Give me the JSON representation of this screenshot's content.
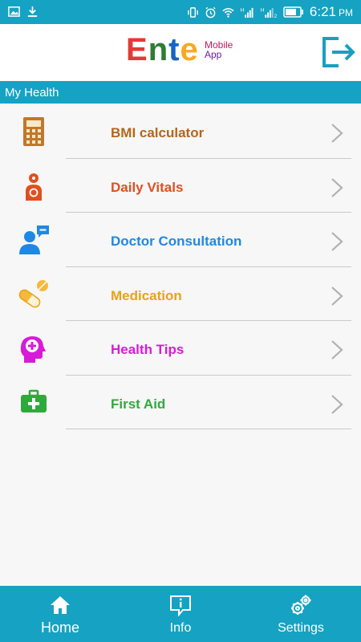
{
  "status_bar": {
    "time": "6:21",
    "ampm": "PM",
    "network_1": "H",
    "network_2": "2"
  },
  "header": {
    "logo_main": [
      "E",
      "n",
      "t",
      "e"
    ],
    "logo_sub_1": "Mobile",
    "logo_sub_2": "App",
    "logout_icon": "logout-icon"
  },
  "section": {
    "title": "My Health"
  },
  "menu": [
    {
      "label": "BMI calculator",
      "icon": "calculator-icon",
      "color": "#b5651d"
    },
    {
      "label": "Daily Vitals",
      "icon": "vitals-icon",
      "color": "#e0501e"
    },
    {
      "label": "Doctor Consultation",
      "icon": "doctor-consultation-icon",
      "color": "#1e88e5"
    },
    {
      "label": "Medication",
      "icon": "pill-icon",
      "color": "#e8a317"
    },
    {
      "label": "Health Tips",
      "icon": "health-tips-icon",
      "color": "#d81bd8"
    },
    {
      "label": "First Aid",
      "icon": "first-aid-icon",
      "color": "#2eaa3c"
    }
  ],
  "bottom_nav": {
    "home": "Home",
    "info": "Info",
    "settings": "Settings"
  },
  "colors": {
    "primary": "#16a2c2",
    "background": "#f7f7f7",
    "divider": "#c9c9c9",
    "chevron": "#b0b0b0"
  }
}
